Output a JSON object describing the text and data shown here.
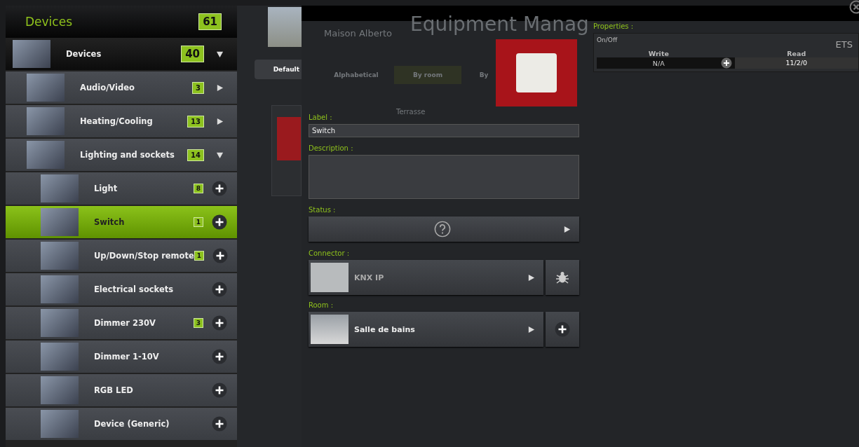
{
  "sidebar": {
    "title": "Devices",
    "count": "61",
    "tree": [
      {
        "label": "Devices",
        "count": "40",
        "expanded": true,
        "selected": false,
        "children": [
          {
            "label": "Audio/Video",
            "count": "3",
            "expanded": false,
            "selected": false
          },
          {
            "label": "Heating/Cooling",
            "count": "13",
            "expanded": false,
            "selected": false
          },
          {
            "label": "Lighting and sockets",
            "count": "14",
            "expanded": true,
            "selected": false,
            "children": [
              {
                "label": "Light",
                "count": "8",
                "selected": false
              },
              {
                "label": "Switch",
                "count": "1",
                "selected": true
              },
              {
                "label": "Up/Down/Stop remote",
                "count": "1",
                "selected": false
              },
              {
                "label": "Electrical sockets",
                "selected": false
              },
              {
                "label": "Dimmer 230V",
                "count": "3",
                "selected": false
              },
              {
                "label": "Dimmer 1-10V",
                "selected": false
              },
              {
                "label": "RGB LED",
                "selected": false
              },
              {
                "label": "Device (Generic)",
                "selected": false
              }
            ]
          }
        ]
      }
    ]
  },
  "background_page": {
    "site": "Maison Alberto",
    "title": "Equipment Manag",
    "tabs": [
      {
        "label": "Default",
        "selected": false
      },
      {
        "label": "Alphabetical",
        "selected": false
      },
      {
        "label": "By room",
        "selected": true
      },
      {
        "label": "By",
        "selected": false
      }
    ],
    "room": "Terrasse"
  },
  "form": {
    "label_caption": "Label :",
    "label_value": "Switch",
    "description_caption": "Description :",
    "status_caption": "Status :",
    "connector_caption": "Connector :",
    "connector": "KNX IP",
    "room_caption": "Room :",
    "room": "Salle de bains"
  },
  "properties": {
    "caption": "Properties :",
    "name": "On/Off",
    "source": "ETS",
    "write_header": "Write",
    "read_header": "Read",
    "write_value": "N/A",
    "read_value": "11/2/0"
  }
}
